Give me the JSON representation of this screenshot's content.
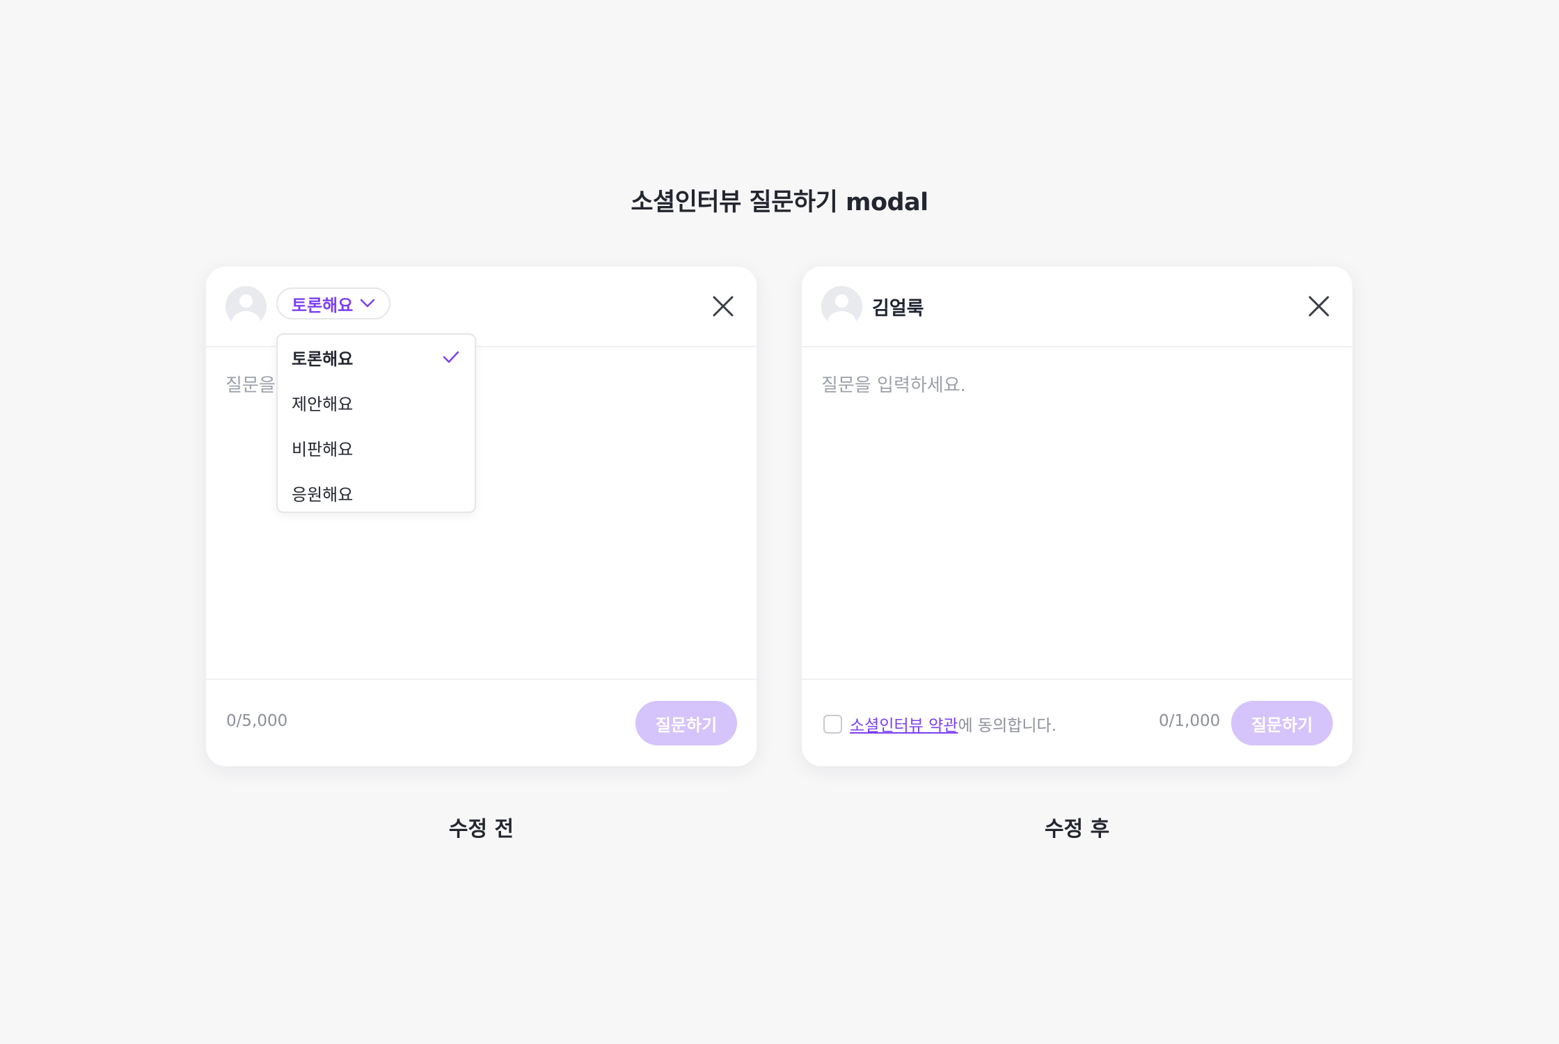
{
  "page": {
    "title": "소셜인터뷰 질문하기 modal"
  },
  "colors": {
    "accent": "#7b3ff2",
    "submit_disabled": "#d5c3fb",
    "placeholder": "#9ca0aa",
    "background": "#f7f7f8"
  },
  "before": {
    "caption": "수정 전",
    "type_select": {
      "selected": "토론해요",
      "icon": "chevron-down-icon"
    },
    "dropdown": {
      "options": [
        {
          "label": "토론해요",
          "checked": true
        },
        {
          "label": "제안해요",
          "checked": false
        },
        {
          "label": "비판해요",
          "checked": false
        },
        {
          "label": "응원해요",
          "checked": false
        }
      ]
    },
    "placeholder": "질문을",
    "counter": "0/5,000",
    "submit_label": "질문하기"
  },
  "after": {
    "caption": "수정 후",
    "username": "김얼룩",
    "placeholder": "질문을 입력하세요.",
    "terms_link": "소셜인터뷰 약관",
    "terms_suffix": "에 동의합니다.",
    "agree_checked": false,
    "counter": "0/1,000",
    "submit_label": "질문하기"
  }
}
